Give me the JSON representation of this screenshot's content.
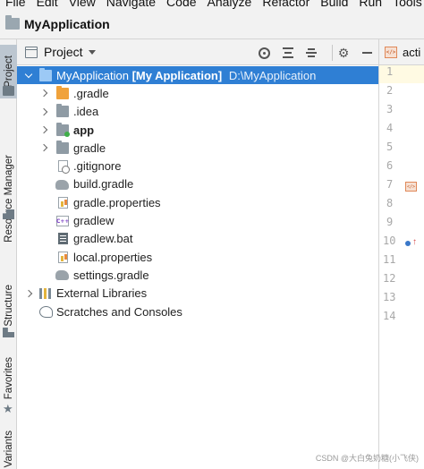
{
  "menubar": {
    "items": [
      "File",
      "Edit",
      "View",
      "Navigate",
      "Code",
      "Analyze",
      "Refactor",
      "Build",
      "Run",
      "Tools"
    ]
  },
  "titlebar": {
    "title": "MyApplication"
  },
  "side_tabs": {
    "project": "Project",
    "resource_manager": "Resource Manager",
    "structure": "Structure",
    "favorites": "Favorites",
    "build_variants": "Variants"
  },
  "project_panel": {
    "title": "Project"
  },
  "tree": {
    "root": {
      "name": "MyApplication",
      "module": "[My Application]",
      "path": "D:\\MyApplication"
    },
    "items": [
      {
        "label": ".gradle"
      },
      {
        "label": ".idea"
      },
      {
        "label": "app"
      },
      {
        "label": "gradle"
      },
      {
        "label": ".gitignore"
      },
      {
        "label": "build.gradle"
      },
      {
        "label": "gradle.properties"
      },
      {
        "label": "gradlew"
      },
      {
        "label": "gradlew.bat"
      },
      {
        "label": "local.properties"
      },
      {
        "label": "settings.gradle"
      }
    ],
    "external_libraries": "External Libraries",
    "scratches": "Scratches and Consoles"
  },
  "editor": {
    "tab_label": "acti",
    "line_numbers": [
      "1",
      "2",
      "3",
      "4",
      "5",
      "6",
      "7",
      "8",
      "9",
      "10",
      "11",
      "12",
      "13",
      "14"
    ]
  },
  "watermark": "CSDN @大白兔奶糖(小飞侠)"
}
